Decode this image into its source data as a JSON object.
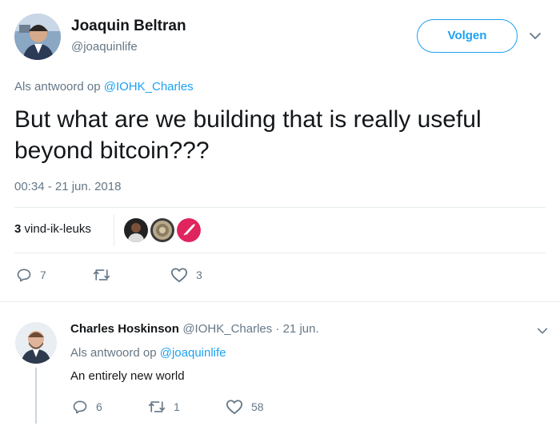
{
  "tweet": {
    "author": {
      "name": "Joaquin Beltran",
      "handle": "@joaquinlife"
    },
    "follow_label": "Volgen",
    "reply_prefix": "Als antwoord op",
    "reply_to": "@IOHK_Charles",
    "text_line1": "But what are we building that is really useful",
    "text_line2": "beyond bitcoin???",
    "timestamp": "00:34 - 21 jun. 2018",
    "likes_number": "3",
    "likes_label": "vind-ik-leuks",
    "replies_count": "7",
    "retweets_count": "",
    "likes_action_count": "3"
  },
  "reply": {
    "author_name": "Charles Hoskinson",
    "handle_date": "@IOHK_Charles · 21 jun.",
    "reply_prefix": "Als antwoord op",
    "reply_to": "@joaquinlife",
    "text": "An entirely new world",
    "replies_count": "6",
    "retweets_count": "1",
    "likes_count": "58"
  },
  "colors": {
    "accent": "#1da1f2",
    "muted": "#657786",
    "text": "#14171a",
    "divider": "#e6ecf0"
  },
  "icons": [
    "reply-icon",
    "retweet-icon",
    "heart-icon",
    "chevron-down-icon"
  ]
}
